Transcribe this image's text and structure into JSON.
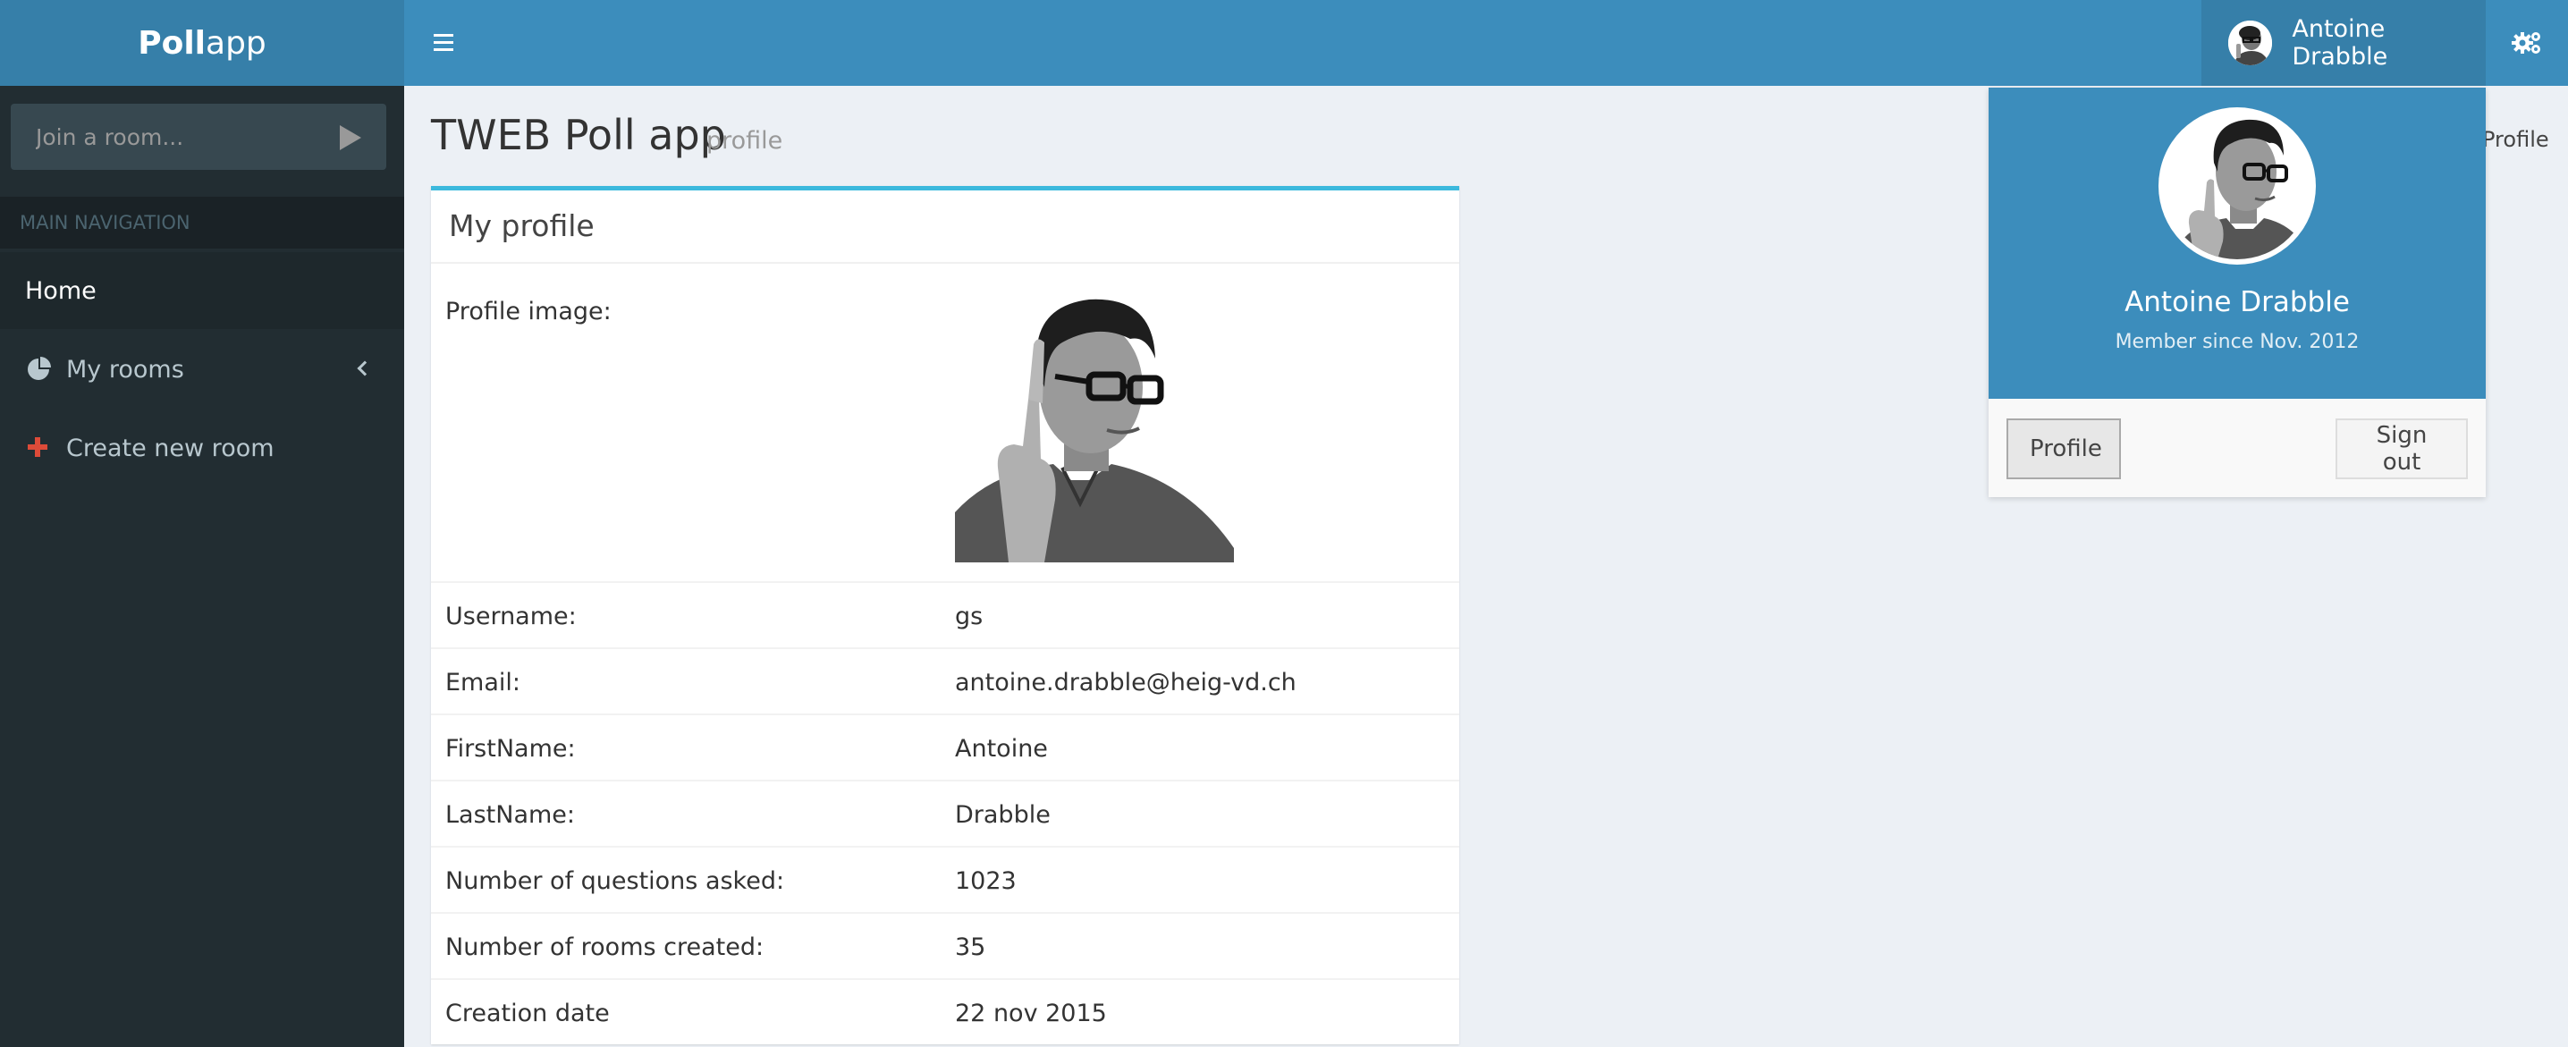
{
  "app": {
    "logo_bold": "Poll",
    "logo_light": "app"
  },
  "topbar": {
    "user_name": "Antoine Drabble"
  },
  "sidebar": {
    "search_placeholder": "Join a room...",
    "nav_header": "MAIN NAVIGATION",
    "items": [
      {
        "label": "Home",
        "icon": "home"
      },
      {
        "label": "My rooms",
        "icon": "pie-chart-icon"
      },
      {
        "label": "Create new room",
        "icon": "plus-icon"
      }
    ]
  },
  "page": {
    "title": "TWEB Poll app",
    "subtitle": "profile",
    "breadcrumb": "Profile"
  },
  "profile_box": {
    "title": "My profile",
    "image_label": "Profile image:",
    "rows": [
      {
        "key": "Username:",
        "value": "gs"
      },
      {
        "key": "Email:",
        "value": "antoine.drabble@heig-vd.ch"
      },
      {
        "key": "FirstName:",
        "value": "Antoine"
      },
      {
        "key": "LastName:",
        "value": "Drabble"
      },
      {
        "key": "Number of questions asked:",
        "value": "1023"
      },
      {
        "key": "Number of rooms created:",
        "value": "35"
      },
      {
        "key": "Creation date",
        "value": "22 nov 2015"
      }
    ]
  },
  "user_dropdown": {
    "name": "Antoine Drabble",
    "member_since": "Member since Nov. 2012",
    "profile_button": "Profile",
    "signout_button": "Sign out"
  },
  "colors": {
    "header": "#3c8dbc",
    "header_dark": "#367fa9",
    "sidebar": "#222d32",
    "box_accent": "#3cb9dd",
    "plus_icon": "#dd4b39"
  }
}
